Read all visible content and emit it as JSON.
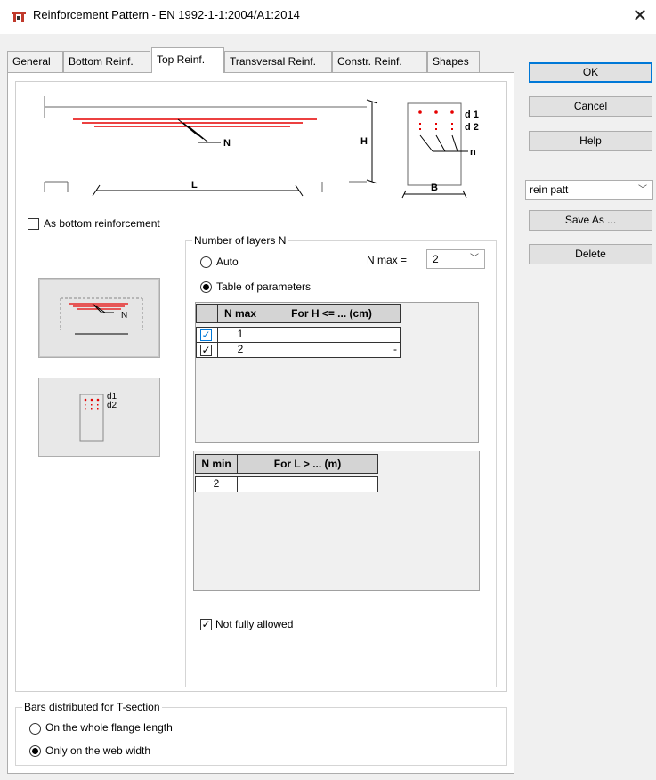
{
  "window": {
    "title": "Reinforcement Pattern - EN 1992-1-1:2004/A1:2014",
    "close_glyph": "✕"
  },
  "tabs": [
    {
      "label": "General"
    },
    {
      "label": "Bottom Reinf."
    },
    {
      "label": "Top Reinf."
    },
    {
      "label": "Transversal Reinf."
    },
    {
      "label": "Constr. Reinf."
    },
    {
      "label": "Shapes"
    }
  ],
  "buttons": {
    "ok": "OK",
    "cancel": "Cancel",
    "help": "Help",
    "save_as": "Save As ...",
    "delete": "Delete"
  },
  "pattern_select": {
    "value": "rein patt",
    "chevron": "﹀"
  },
  "diagram": {
    "beam_label_N": "N",
    "beam_label_H": "H",
    "beam_label_L": "L",
    "section_label_d1": "d 1",
    "section_label_d2": "d 2",
    "section_label_n": "n",
    "section_label_B": "B"
  },
  "as_bottom": {
    "label": "As bottom reinforcement",
    "checked": false
  },
  "layers_group": {
    "legend": "Number of layers N",
    "auto_label": "Auto",
    "nmax_label": "N max =",
    "nmax_value": "2",
    "table_label": "Table of parameters",
    "selected": "table"
  },
  "table_h": {
    "headers": [
      "N max",
      "For H <= ... (cm)"
    ],
    "rows": [
      {
        "checked": true,
        "nmax": "1",
        "h": ""
      },
      {
        "checked": true,
        "nmax": "2",
        "h": "-"
      }
    ]
  },
  "table_l": {
    "headers": [
      "N min",
      "For L > ... (m)"
    ],
    "rows": [
      {
        "nmin": "2",
        "l": ""
      }
    ]
  },
  "not_fully_allowed": {
    "label": "Not fully allowed",
    "checked": true
  },
  "thumbs": {
    "thumb1_label": "N",
    "thumb2_d1": "d1",
    "thumb2_d2": "d2"
  },
  "tsection_group": {
    "legend": "Bars distributed for T-section",
    "opt1": "On the whole flange length",
    "opt2": "Only on the web width",
    "selected": "web"
  },
  "check_glyph": "✓",
  "colors": {
    "rebar_red": "#e60000",
    "accent_blue": "#0078d7"
  }
}
